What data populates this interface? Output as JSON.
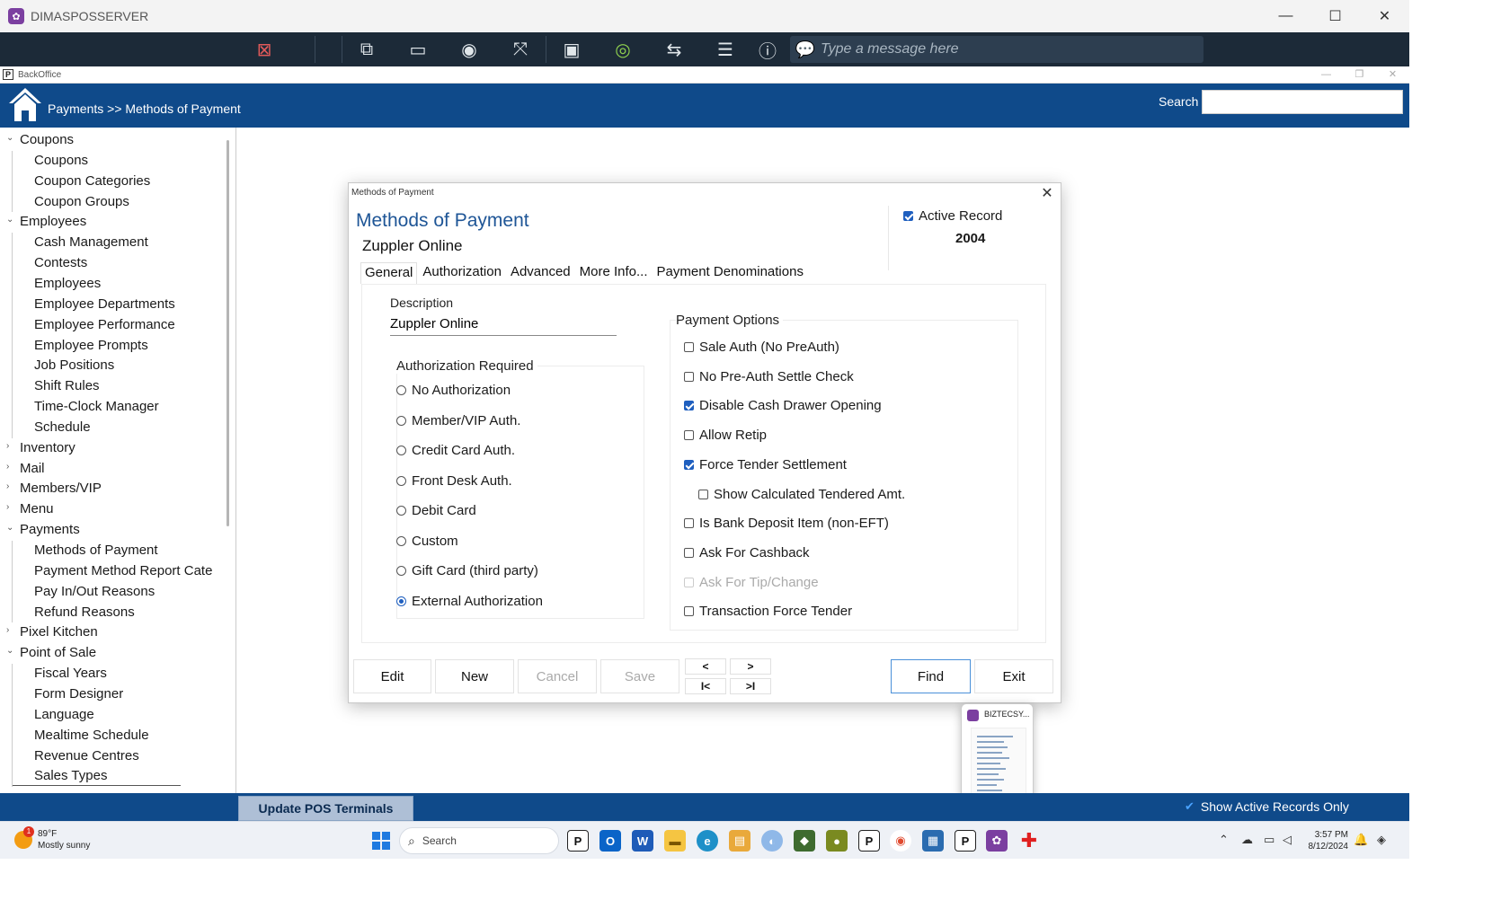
{
  "remote_window": {
    "title": "DIMASPOSSERVER",
    "message_placeholder": "Type a message here"
  },
  "backoffice": {
    "title": "BackOffice"
  },
  "header": {
    "breadcrumb": "Payments >> Methods of Payment",
    "search_label": "Search",
    "search_value": ""
  },
  "sidebar": {
    "items": [
      {
        "label": "Coupons",
        "level": 0,
        "expanded": true
      },
      {
        "label": "Coupons",
        "level": 1
      },
      {
        "label": "Coupon Categories",
        "level": 1
      },
      {
        "label": "Coupon Groups",
        "level": 1
      },
      {
        "label": "Employees",
        "level": 0,
        "expanded": true
      },
      {
        "label": "Cash Management",
        "level": 1
      },
      {
        "label": "Contests",
        "level": 1
      },
      {
        "label": "Employees",
        "level": 1
      },
      {
        "label": "Employee Departments",
        "level": 1
      },
      {
        "label": "Employee Performance",
        "level": 1
      },
      {
        "label": "Employee Prompts",
        "level": 1
      },
      {
        "label": "Job Positions",
        "level": 1
      },
      {
        "label": "Shift Rules",
        "level": 1
      },
      {
        "label": "Time-Clock Manager",
        "level": 1
      },
      {
        "label": "Schedule",
        "level": 1
      },
      {
        "label": "Inventory",
        "level": 0,
        "expanded": false
      },
      {
        "label": "Mail",
        "level": 0,
        "expanded": false
      },
      {
        "label": "Members/VIP",
        "level": 0,
        "expanded": false
      },
      {
        "label": "Menu",
        "level": 0,
        "expanded": false
      },
      {
        "label": "Payments",
        "level": 0,
        "expanded": true
      },
      {
        "label": "Methods of Payment",
        "level": 1
      },
      {
        "label": "Payment Method Report Cate",
        "level": 1
      },
      {
        "label": "Pay In/Out Reasons",
        "level": 1
      },
      {
        "label": "Refund Reasons",
        "level": 1
      },
      {
        "label": "Pixel Kitchen",
        "level": 0,
        "expanded": false
      },
      {
        "label": "Point of Sale",
        "level": 0,
        "expanded": true
      },
      {
        "label": "Fiscal Years",
        "level": 1
      },
      {
        "label": "Form Designer",
        "level": 1
      },
      {
        "label": "Language",
        "level": 1
      },
      {
        "label": "Mealtime Schedule",
        "level": 1
      },
      {
        "label": "Revenue Centres",
        "level": 1
      },
      {
        "label": "Sales Types",
        "level": 1
      }
    ]
  },
  "dialog": {
    "caption": "Methods of Payment",
    "heading": "Methods of Payment",
    "subtitle": "Zuppler Online",
    "active_record_label": "Active Record",
    "active_record": true,
    "record_id": "2004",
    "tabs": [
      "General",
      "Authorization",
      "Advanced",
      "More Info...",
      "Payment Denominations"
    ],
    "active_tab": "General",
    "description_label": "Description",
    "description_value": "Zuppler Online",
    "authorization_title": "Authorization Required",
    "authorization_options": [
      {
        "label": "No Authorization",
        "selected": false
      },
      {
        "label": "Member/VIP Auth.",
        "selected": false
      },
      {
        "label": "Credit Card Auth.",
        "selected": false
      },
      {
        "label": "Front Desk Auth.",
        "selected": false
      },
      {
        "label": "Debit Card",
        "selected": false
      },
      {
        "label": "Custom",
        "selected": false
      },
      {
        "label": "Gift Card (third party)",
        "selected": false
      },
      {
        "label": "External Authorization",
        "selected": true
      }
    ],
    "payment_options_title": "Payment Options",
    "payment_options": [
      {
        "label": "Sale Auth (No PreAuth)",
        "checked": false,
        "indent": false,
        "disabled": false
      },
      {
        "label": "No Pre-Auth Settle Check",
        "checked": false,
        "indent": false,
        "disabled": false
      },
      {
        "label": "Disable Cash Drawer Opening",
        "checked": true,
        "indent": false,
        "disabled": false
      },
      {
        "label": "Allow Retip",
        "checked": false,
        "indent": false,
        "disabled": false
      },
      {
        "label": "Force Tender Settlement",
        "checked": true,
        "indent": false,
        "disabled": false
      },
      {
        "label": "Show Calculated Tendered Amt.",
        "checked": false,
        "indent": true,
        "disabled": false
      },
      {
        "label": "Is Bank Deposit Item (non-EFT)",
        "checked": false,
        "indent": false,
        "disabled": false
      },
      {
        "label": "Ask For Cashback",
        "checked": false,
        "indent": false,
        "disabled": false
      },
      {
        "label": "Ask For Tip/Change",
        "checked": false,
        "indent": false,
        "disabled": true
      },
      {
        "label": "Transaction Force Tender",
        "checked": false,
        "indent": false,
        "disabled": false
      }
    ],
    "buttons": {
      "edit": "Edit",
      "new": "New",
      "cancel": "Cancel",
      "save": "Save",
      "find": "Find",
      "exit": "Exit"
    },
    "nav": {
      "prev": "<",
      "next": ">",
      "first": "I<",
      "last": ">I"
    }
  },
  "thumbnail": {
    "title": "BIZTECSY..."
  },
  "statusbar": {
    "update_button": "Update POS Terminals",
    "show_active_label": "Show Active Records Only",
    "show_active": true
  },
  "taskbar": {
    "weather_temp": "89°F",
    "weather_desc": "Mostly sunny",
    "weather_badge": "1",
    "search_label": "Search",
    "time": "3:57 PM",
    "date": "8/12/2024"
  },
  "colors": {
    "header_blue": "#0f4a8a",
    "toolbar_dark": "#1c2a38",
    "accent": "#1f5fbf",
    "heading": "#1e5596"
  }
}
